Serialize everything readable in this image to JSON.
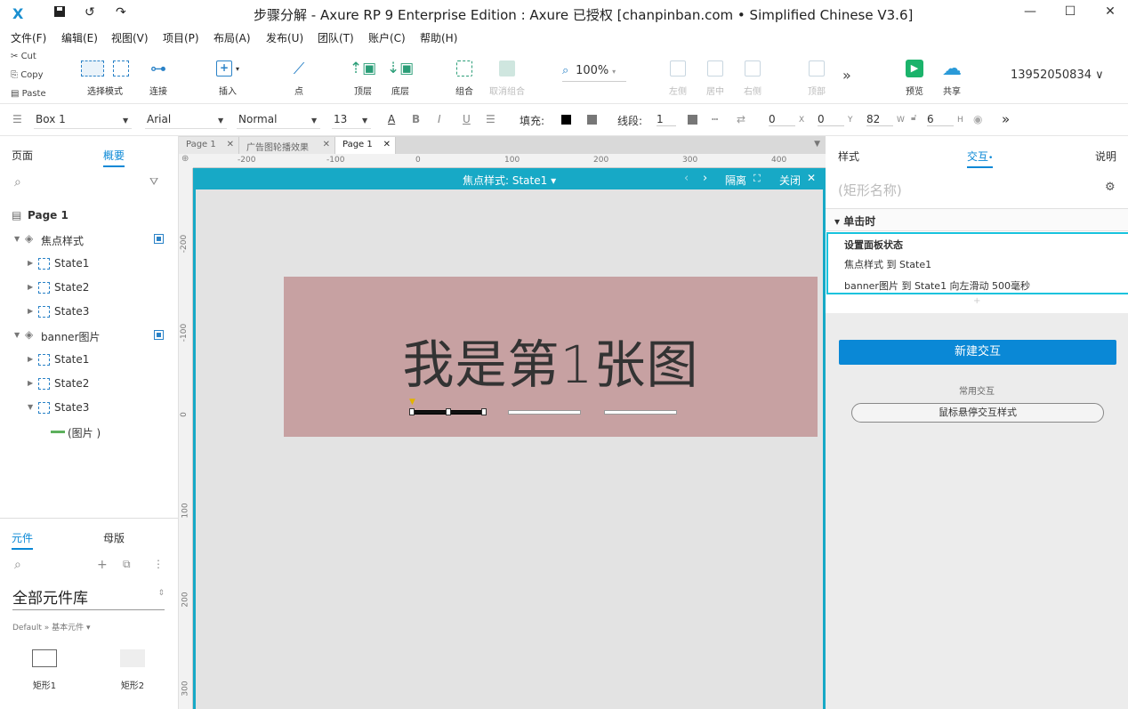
{
  "window": {
    "title": "步骤分解 - Axure RP 9 Enterprise Edition : Axure 已授权     [chanpinban.com • Simplified Chinese V3.6]"
  },
  "menu": [
    "文件(F)",
    "编辑(E)",
    "视图(V)",
    "项目(P)",
    "布局(A)",
    "发布(U)",
    "团队(T)",
    "账户(C)",
    "帮助(H)"
  ],
  "clipboard": {
    "cut": "Cut",
    "copy": "Copy",
    "paste": "Paste"
  },
  "toolbar": {
    "select_mode": "选择模式",
    "connect": "连接",
    "insert": "插入",
    "point": "点",
    "top_layer": "顶层",
    "bottom_layer": "底层",
    "group": "组合",
    "ungroup": "取消组合",
    "zoom": "100%",
    "align_left": "左侧",
    "align_center": "居中",
    "align_right": "右侧",
    "align_top": "顶部",
    "preview": "预览",
    "share": "共享",
    "account": "13952050834"
  },
  "format": {
    "style": "Box 1",
    "font": "Arial",
    "weight": "Normal",
    "size": "13",
    "fill_label": "填充:",
    "line_label": "线段:",
    "line_value": "1",
    "x": "0",
    "x_label": "X",
    "y": "0",
    "y_label": "Y",
    "w": "82",
    "w_label": "W",
    "h": "6",
    "h_label": "H"
  },
  "left_panel": {
    "tab_pages": "页面",
    "tab_outline": "概要",
    "page_name": "Page 1",
    "tree": [
      {
        "label": "焦点样式",
        "kind": "panel"
      },
      {
        "label": "State1",
        "kind": "state"
      },
      {
        "label": "State2",
        "kind": "state"
      },
      {
        "label": "State3",
        "kind": "state"
      },
      {
        "label": "banner图片",
        "kind": "panel"
      },
      {
        "label": "State1",
        "kind": "state"
      },
      {
        "label": "State2",
        "kind": "state"
      },
      {
        "label": "State3",
        "kind": "state"
      },
      {
        "label": "(图片 )",
        "kind": "image"
      }
    ],
    "tab_widgets": "元件",
    "tab_masters": "母版",
    "library": "全部元件库",
    "library_path": "Default » 基本元件 ▾",
    "widgets": [
      "矩形1",
      "矩形2"
    ]
  },
  "doc_tabs": [
    "Page 1",
    "广告图轮播效果",
    "Page 1"
  ],
  "ruler_h": [
    "-200",
    "-100",
    "0",
    "100",
    "200",
    "300",
    "400"
  ],
  "ruler_v": [
    "-200",
    "-100",
    "0",
    "100",
    "200",
    "300"
  ],
  "state_bar": {
    "label": "焦点样式: State1 ▾",
    "isolate": "隔离",
    "close": "关闭"
  },
  "canvas": {
    "banner_text": "我是第1张图"
  },
  "right_panel": {
    "tab_style": "样式",
    "tab_interact": "交互",
    "tab_notes": "说明",
    "name_placeholder": "(矩形名称)",
    "event": "▾ 单击时",
    "action_title": "设置面板状态",
    "action_line1": "焦点样式 到 State1",
    "action_line2": "banner图片 到 State1 向左滑动 500毫秒",
    "new_interaction": "新建交互",
    "common": "常用交互",
    "hover_style": "鼠标悬停交互样式"
  },
  "colors": {
    "accent": "#17a9c6",
    "primary_button": "#0a88d6",
    "banner": "#c7a1a2"
  }
}
